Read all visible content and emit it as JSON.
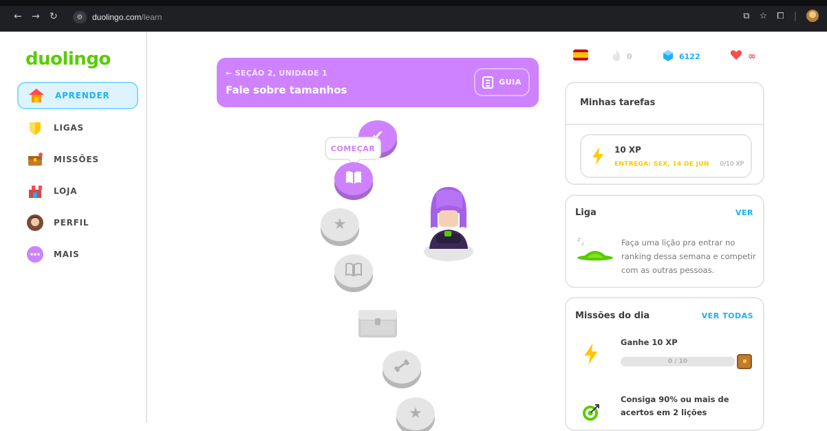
{
  "browser": {
    "url_host": "duolingo.com",
    "url_path": "/learn"
  },
  "sidebar": {
    "logo": "duolingo",
    "items": [
      {
        "label": "APRENDER",
        "icon": "home-icon",
        "active": true
      },
      {
        "label": "LIGAS",
        "icon": "shield-icon",
        "active": false
      },
      {
        "label": "MISSÕES",
        "icon": "treasure-chest-icon",
        "active": false
      },
      {
        "label": "LOJA",
        "icon": "shop-icon",
        "active": false
      },
      {
        "label": "PERFIL",
        "icon": "profile-avatar-icon",
        "active": false
      },
      {
        "label": "MAIS",
        "icon": "more-dots-icon",
        "active": false
      }
    ]
  },
  "unit": {
    "section": "← SEÇÃO 2, UNIDADE 1",
    "title": "Fale sobre tamanhos",
    "guide_label": "GUIA",
    "start_tooltip": "COMEÇAR"
  },
  "stats": {
    "streak": "0",
    "gems": "6122",
    "hearts": "∞"
  },
  "tasks": {
    "title": "Minhas tarefas",
    "item_title": "10 XP",
    "due": "ENTREGA: SEX, 14 DE JUN",
    "progress_text": "0/10 XP"
  },
  "league": {
    "title": "Liga",
    "link": "VER",
    "message": "Faça uma lição pra entrar no ranking dessa semana e competir com as outras pessoas."
  },
  "quests": {
    "title": "Missões do dia",
    "link": "VER TODAS",
    "items": [
      {
        "title": "Ganhe 10 XP",
        "progress_text": "0 / 10",
        "progress": 0
      },
      {
        "title": "Consiga 90% ou mais de acertos em 2 lições"
      }
    ]
  },
  "colors": {
    "brand_green": "#58cc02",
    "unit_purple": "#ce82ff",
    "link_blue": "#1cb0f6",
    "gem_blue": "#1cb0f6",
    "heart_red": "#ff4b4b",
    "due_yellow": "#ffc800"
  }
}
